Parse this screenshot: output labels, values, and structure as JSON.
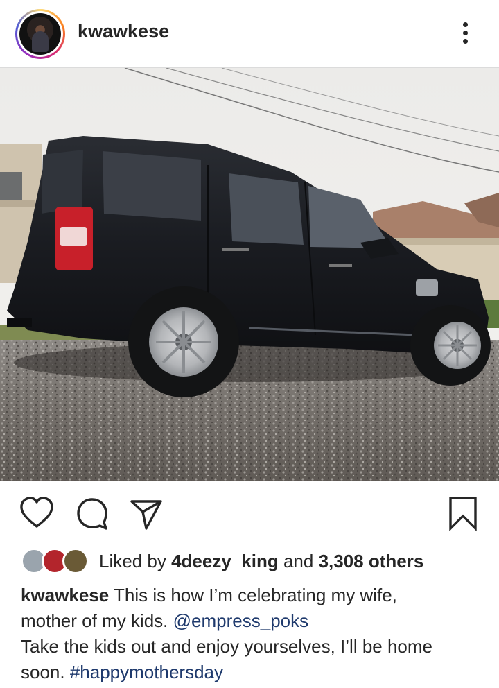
{
  "post": {
    "username": "kwawkese",
    "liked_by_prefix": "Liked by",
    "liked_by_user": "4deezy_king",
    "liked_and": "and",
    "liked_others": "3,308 others",
    "caption": {
      "username": "kwawkese",
      "line1": "This is how I’m celebrating my wife,",
      "line2": "mother of my kids.",
      "mention": "@empress_poks",
      "line3": "Take the kids out and enjoy yourselves, I’ll be home",
      "line4": "soon.",
      "hashtag": "#happymothersday"
    }
  },
  "icons": {
    "more": "more-vertical-icon",
    "like": "heart-icon",
    "comment": "comment-icon",
    "share": "send-icon",
    "save": "bookmark-icon"
  },
  "colors": {
    "text": "#262626",
    "link": "#1f3a6d",
    "divider": "#dbdbdb"
  }
}
